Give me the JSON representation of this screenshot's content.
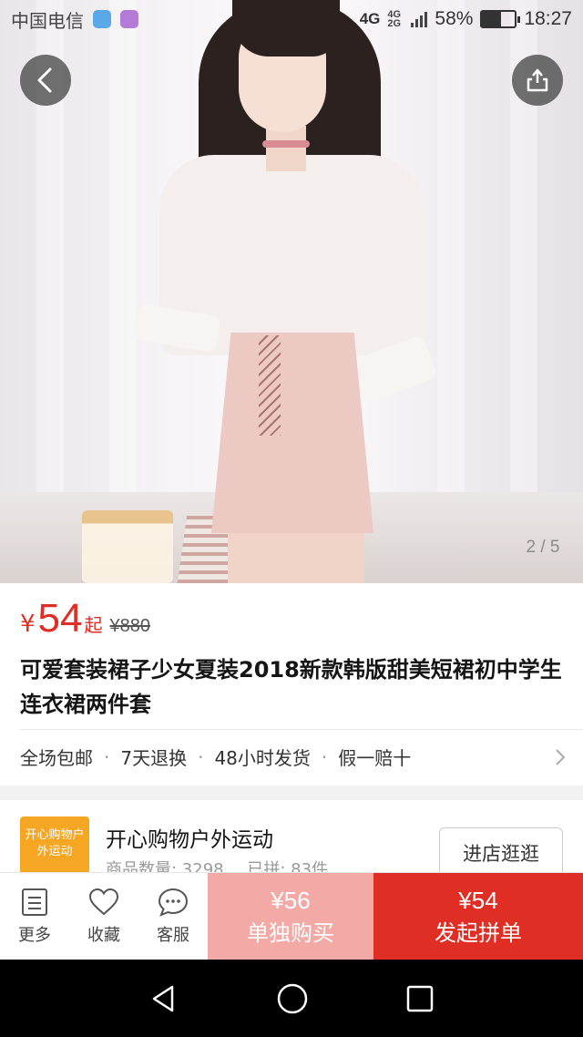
{
  "status_bar": {
    "carrier": "中国电信",
    "network_top": "4G",
    "network_sub": "4G 2G",
    "battery": "58%",
    "battery_level": 0.58,
    "time": "18:27"
  },
  "gallery": {
    "page_indicator": "2 / 5",
    "back_icon": "chevron-left-icon",
    "share_icon": "share-icon"
  },
  "product": {
    "currency": "¥",
    "price": "54",
    "price_suffix": "起",
    "original_price": "¥880",
    "title": "可爱套装裙子少女夏装2018新款韩版甜美短裙初中学生连衣裙两件套",
    "services": [
      "全场包邮",
      "7天退换",
      "48小时发货",
      "假一赔十"
    ]
  },
  "store": {
    "logo_text": "开心购物户外运动",
    "name": "开心购物户外运动",
    "stats": [
      "商品数量: 3298",
      "已拼: 83件"
    ],
    "enter_button": "进店逛逛"
  },
  "actions": {
    "more": "更多",
    "favorite": "收藏",
    "service": "客服",
    "solo_price": "¥56",
    "solo_label": "单独购买",
    "group_price": "¥54",
    "group_label": "发起拼单"
  },
  "colors": {
    "accent": "#e02e24",
    "solo_button": "#f3aaa6",
    "store_logo": "#f5a623"
  }
}
